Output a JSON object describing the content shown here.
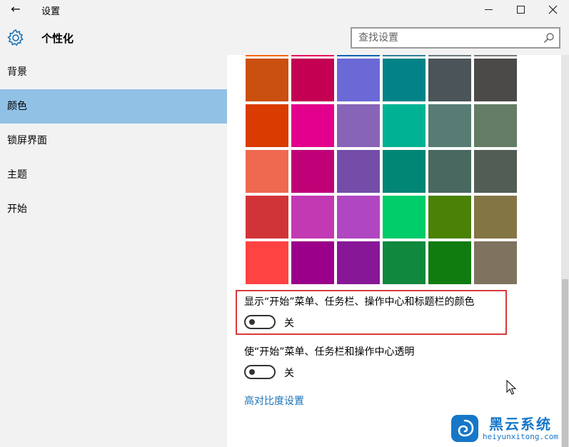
{
  "window": {
    "title": "设置",
    "back_glyph": "←"
  },
  "header": {
    "title": "个性化",
    "search_placeholder": "查找设置"
  },
  "sidebar": {
    "items": [
      {
        "label": "背景"
      },
      {
        "label": "颜色"
      },
      {
        "label": "锁屏界面"
      },
      {
        "label": "主题"
      },
      {
        "label": "开始"
      }
    ],
    "selected": "颜色",
    "selected_color": "#92c1e6"
  },
  "color_grid": {
    "rows": [
      [
        "#ca5010",
        "#c30052",
        "#6b69d6",
        "#038387",
        "#4a5459",
        "#4c4a48"
      ],
      [
        "#da3b01",
        "#e3008c",
        "#8764b8",
        "#00b294",
        "#567c73",
        "#647c64"
      ],
      [
        "#ef6950",
        "#bf0077",
        "#744da9",
        "#018574",
        "#486860",
        "#525e54"
      ],
      [
        "#d13438",
        "#c239b3",
        "#b146c2",
        "#00cc6a",
        "#498205",
        "#847545"
      ],
      [
        "#ff4343",
        "#9a0089",
        "#881798",
        "#10893e",
        "#107c10",
        "#7e735f"
      ]
    ],
    "top_partial_row": [
      "#f7630c",
      "#ea005e",
      "#0063b1",
      "#2d7d9a",
      "#69797e",
      "#767676"
    ]
  },
  "settings": {
    "show_color": {
      "label": "显示“开始”菜单、任务栏、操作中心和标题栏的颜色",
      "state": "关"
    },
    "transparent": {
      "label": "使“开始”菜单、任务栏和操作中心透明",
      "state": "关"
    },
    "high_contrast_link": "高对比度设置"
  },
  "watermark": {
    "title": "黑云系统",
    "url": "heiyunxitong.com",
    "color": "#1677c9"
  },
  "accent": {
    "highlight_border": "#d93a3a",
    "link_color": "#1a73b8"
  }
}
